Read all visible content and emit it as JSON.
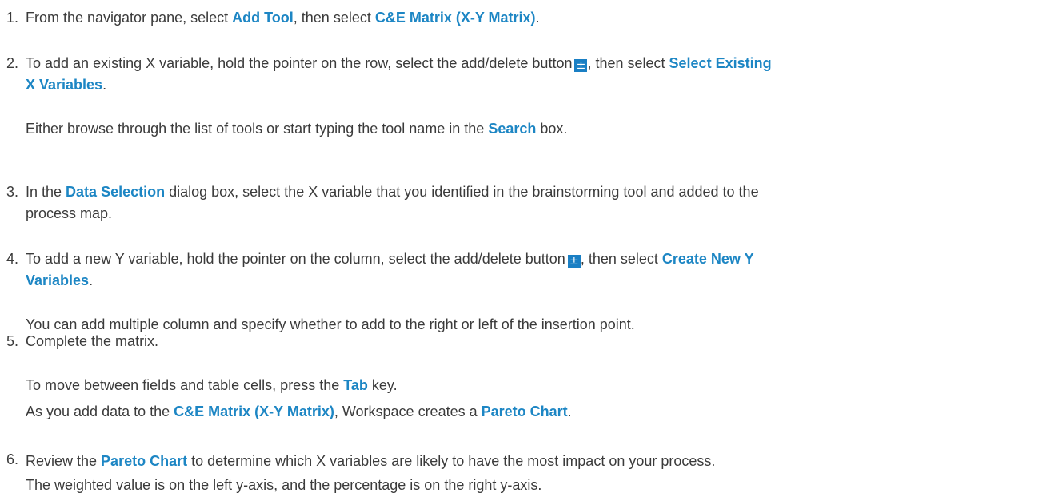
{
  "steps": [
    {
      "number": "1.",
      "lines": [
        [
          "From the navigator pane, select ",
          {
            "hl": "Add Tool"
          },
          ", then select ",
          {
            "hl": "C&E Matrix (X-Y Matrix)"
          },
          "."
        ]
      ]
    },
    {
      "number": "2.",
      "lines": [
        [
          "To add an existing X variable, hold the pointer on the row, select the add/delete button",
          {
            "icon": "add-delete-icon",
            "glyph": "±"
          },
          ", then select ",
          {
            "hl": "Select Existing"
          }
        ],
        [
          {
            "hl": "X Variables"
          },
          "."
        ]
      ],
      "notes": [
        [
          "Either browse through the list of tools or start typing the tool name in the ",
          {
            "hl": "Search"
          },
          " box."
        ]
      ]
    },
    {
      "number": "3.",
      "lines": [
        [
          "In the ",
          {
            "hl": "Data Selection"
          },
          " dialog box, select the X variable that you identified in the brainstorming tool and added to the"
        ],
        [
          "process map."
        ]
      ]
    },
    {
      "number": "4.",
      "lines": [
        [
          "To add a new Y variable, hold the pointer on the column, select the add/delete button",
          {
            "icon": "add-delete-icon",
            "glyph": "±"
          },
          ", then select ",
          {
            "hl": "Create New Y"
          }
        ],
        [
          {
            "hl": "Variables"
          },
          "."
        ]
      ],
      "notes": [
        [
          "You can add multiple column and specify whether to add to the right or left of the insertion point."
        ]
      ]
    },
    {
      "number": "5.",
      "lines": [
        [
          "Complete the matrix."
        ]
      ],
      "notes": [
        [
          "To move between fields and table cells, press the ",
          {
            "hl": "Tab"
          },
          " key."
        ],
        [
          "As you add data to the ",
          {
            "hl": "C&E Matrix (X-Y Matrix)"
          },
          ", Workspace creates a ",
          {
            "hl": "Pareto Chart"
          },
          "."
        ]
      ]
    },
    {
      "number": "6.",
      "lines": [
        [
          "Review the ",
          {
            "hl": "Pareto Chart"
          },
          " to determine which X variables are likely to have the most impact on your process."
        ],
        [
          "The weighted value is on the left y-axis, and the percentage is on the right y-axis."
        ]
      ]
    }
  ]
}
